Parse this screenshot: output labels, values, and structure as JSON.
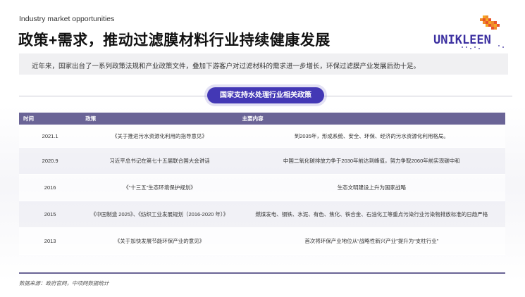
{
  "header": {
    "eyebrow": "Industry market opportunities",
    "title": "政策+需求，推动过滤膜材料行业持续健康发展",
    "logo_text": "UNIKLEEN"
  },
  "intro": "近年来，国家出台了一系列政策法规和产业政策文件，叠加下游客户对过滤材料的需求进一步增长，环保过滤膜产业发展后劲十足。",
  "section_pill": "国家支持水处理行业相关政策",
  "table": {
    "headers": [
      "时间",
      "政策",
      "主要内容"
    ],
    "rows": [
      {
        "time": "2021.1",
        "policy": "《关于推进污水资源化利用的指导意见》",
        "content": "到2035年，形成系统、安全、环保、经济的污水资源化利用格局。"
      },
      {
        "time": "2020.9",
        "policy": "习近平总书记在第七十五届联合国大会讲话",
        "content": "中国二氧化碳排放力争于2030年前达到峰值，努力争取2060年前实现碳中和"
      },
      {
        "time": "2016",
        "policy": "《“十三五”生态环境保护规划》",
        "content": "生态文明建设上升为国家战略"
      },
      {
        "time": "2015",
        "policy": "《中国制造 2025》、《纺织工业发展规划（2016-2020 年）》",
        "content": "燃煤发电、钢铁、水泥、有色、焦化、铁合金、石油化工等重点污染行业污染物排放标准的日趋严格"
      },
      {
        "time": "2013",
        "policy": "《关于加快发展节能环保产业的意见》",
        "content": "首次将环保产业地位从“战略性新兴产业”提升为“支柱行业”"
      }
    ]
  },
  "source": "数据来源：政府官网，中项网数据统计",
  "colors": {
    "accent": "#4338b5",
    "table_header": "#6a6496",
    "logo_orange": "#f08a2b",
    "logo_purple": "#3b2fa0"
  }
}
